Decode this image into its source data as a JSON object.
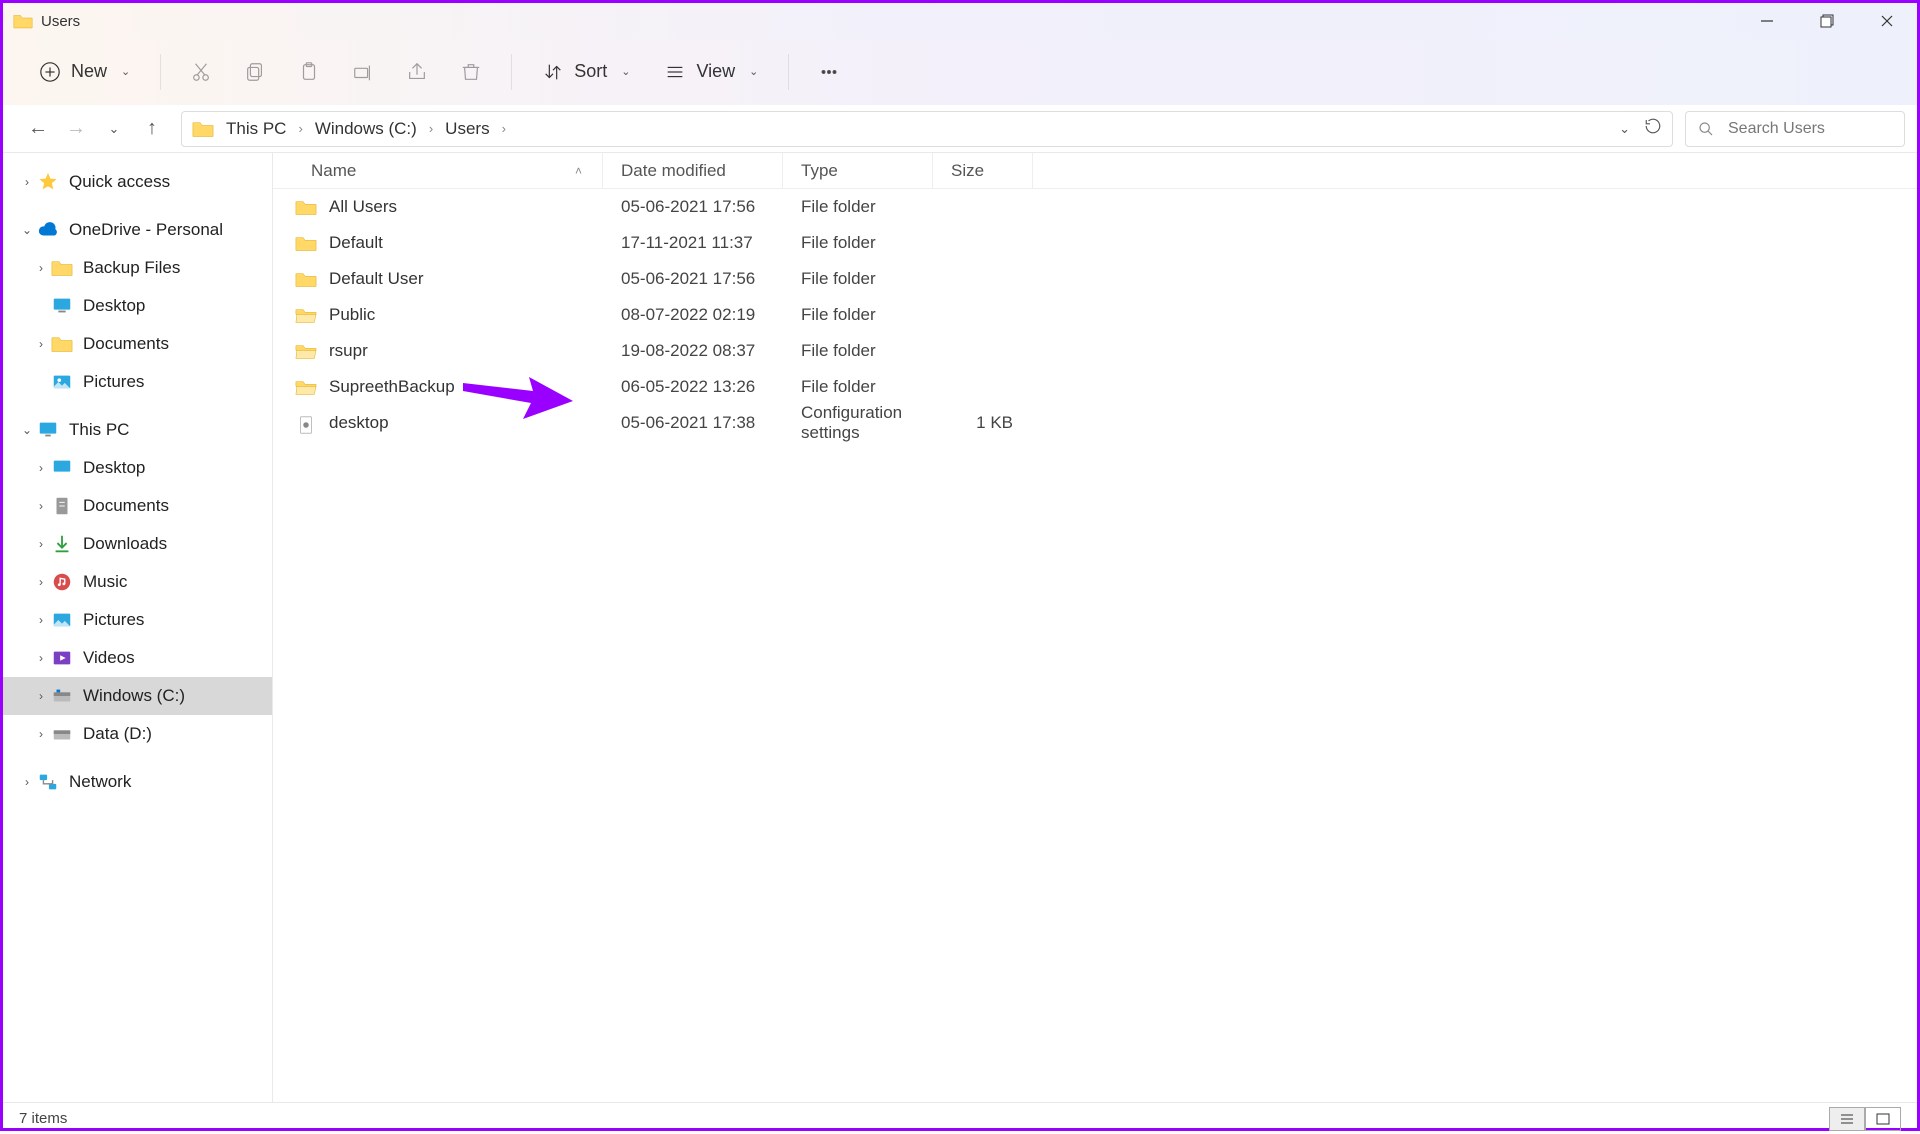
{
  "title_bar": {
    "label": "Users"
  },
  "toolbar": {
    "new_label": "New",
    "sort_label": "Sort",
    "view_label": "View"
  },
  "breadcrumb": {
    "items": [
      "This PC",
      "Windows (C:)",
      "Users"
    ]
  },
  "search": {
    "placeholder": "Search Users"
  },
  "sidebar": {
    "quick_access": "Quick access",
    "onedrive": "OneDrive - Personal",
    "onedrive_children": [
      "Backup Files",
      "Desktop",
      "Documents",
      "Pictures"
    ],
    "this_pc": "This PC",
    "this_pc_children": [
      "Desktop",
      "Documents",
      "Downloads",
      "Music",
      "Pictures",
      "Videos",
      "Windows (C:)",
      "Data (D:)"
    ],
    "network": "Network"
  },
  "columns": {
    "name": "Name",
    "date": "Date modified",
    "type": "Type",
    "size": "Size"
  },
  "rows": [
    {
      "name": "All Users",
      "date": "05-06-2021 17:56",
      "type": "File folder",
      "size": "",
      "icon": "folder"
    },
    {
      "name": "Default",
      "date": "17-11-2021 11:37",
      "type": "File folder",
      "size": "",
      "icon": "folder"
    },
    {
      "name": "Default User",
      "date": "05-06-2021 17:56",
      "type": "File folder",
      "size": "",
      "icon": "folder"
    },
    {
      "name": "Public",
      "date": "08-07-2022 02:19",
      "type": "File folder",
      "size": "",
      "icon": "folder-open"
    },
    {
      "name": "rsupr",
      "date": "19-08-2022 08:37",
      "type": "File folder",
      "size": "",
      "icon": "folder-open"
    },
    {
      "name": "SupreethBackup",
      "date": "06-05-2022 13:26",
      "type": "File folder",
      "size": "",
      "icon": "folder-open"
    },
    {
      "name": "desktop",
      "date": "05-06-2021 17:38",
      "type": "Configuration settings",
      "size": "1 KB",
      "icon": "file"
    }
  ],
  "status": {
    "count": "7 items"
  }
}
